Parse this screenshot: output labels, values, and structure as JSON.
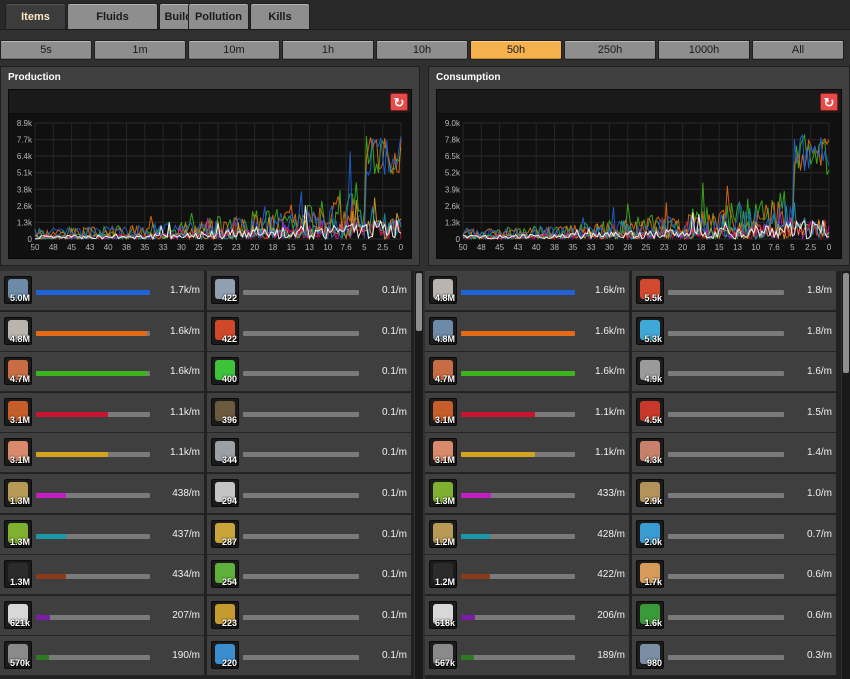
{
  "tabs": [
    {
      "label": "Items",
      "active": true
    },
    {
      "label": "Fluids",
      "active": false
    },
    {
      "label": "Buildings",
      "active": false
    },
    {
      "label": "Pollution",
      "active": false
    },
    {
      "label": "Kills",
      "active": false
    }
  ],
  "timeframes": [
    {
      "label": "5s",
      "active": false
    },
    {
      "label": "1m",
      "active": false
    },
    {
      "label": "10m",
      "active": false
    },
    {
      "label": "1h",
      "active": false
    },
    {
      "label": "10h",
      "active": false
    },
    {
      "label": "50h",
      "active": true
    },
    {
      "label": "250h",
      "active": false
    },
    {
      "label": "1000h",
      "active": false
    },
    {
      "label": "All",
      "active": false
    }
  ],
  "production": {
    "title": "Production",
    "reset_label": "↻",
    "y_ticks": [
      "8.9k",
      "7.7k",
      "6.4k",
      "5.1k",
      "3.8k",
      "2.6k",
      "1.3k",
      "0"
    ],
    "x_ticks": [
      "50",
      "48",
      "45",
      "43",
      "40",
      "38",
      "35",
      "33",
      "30",
      "28",
      "25",
      "23",
      "20",
      "18",
      "15",
      "13",
      "10",
      "7.6",
      "5",
      "2.5",
      "0"
    ],
    "left_items": [
      {
        "icon": "iron-ore-icon",
        "count": "5.0M",
        "rate": "1.7k/m",
        "fill": 1.0,
        "color": "#1f63d6",
        "ic": "#6d8aa8"
      },
      {
        "icon": "stone-icon",
        "count": "4.8M",
        "rate": "1.6k/m",
        "fill": 0.97,
        "color": "#e36a16",
        "ic": "#b9b4ad"
      },
      {
        "icon": "copper-cable-icon",
        "count": "4.7M",
        "rate": "1.6k/m",
        "fill": 0.97,
        "color": "#3bb41e",
        "ic": "#c86d43"
      },
      {
        "icon": "copper-ore-icon",
        "count": "3.1M",
        "rate": "1.1k/m",
        "fill": 0.63,
        "color": "#c8142f",
        "ic": "#c65e2c"
      },
      {
        "icon": "copper-plate-icon",
        "count": "3.1M",
        "rate": "1.1k/m",
        "fill": 0.63,
        "color": "#d5a41f",
        "ic": "#d98a6a"
      },
      {
        "icon": "iron-gear-icon",
        "count": "1.3M",
        "rate": "438/m",
        "fill": 0.26,
        "color": "#c21ec4",
        "ic": "#b69a56"
      },
      {
        "icon": "electronic-circuit-icon",
        "count": "1.3M",
        "rate": "437/m",
        "fill": 0.26,
        "color": "#1a98a8",
        "ic": "#7fb030"
      },
      {
        "icon": "coal-icon",
        "count": "1.3M",
        "rate": "434/m",
        "fill": 0.26,
        "color": "#8a3a18",
        "ic": "#2b2b2b"
      },
      {
        "icon": "iron-plate-icon",
        "count": "621k",
        "rate": "207/m",
        "fill": 0.12,
        "color": "#7a1ca8",
        "ic": "#d8d8d8"
      },
      {
        "icon": "gear-wheel-icon",
        "count": "570k",
        "rate": "190/m",
        "fill": 0.11,
        "color": "#2e7a22",
        "ic": "#8a8a8a"
      }
    ],
    "right_items": [
      {
        "icon": "pipe-icon",
        "count": "422",
        "rate": "0.1/m",
        "fill": 0.0,
        "color": "#888888",
        "ic": "#8fa0b0"
      },
      {
        "icon": "red-wire-icon",
        "count": "422",
        "rate": "0.1/m",
        "fill": 0.0,
        "color": "#888888",
        "ic": "#d0482a"
      },
      {
        "icon": "green-wire-icon",
        "count": "400",
        "rate": "0.1/m",
        "fill": 0.0,
        "color": "#888888",
        "ic": "#3ec23a"
      },
      {
        "icon": "small-pole-icon",
        "count": "396",
        "rate": "0.1/m",
        "fill": 0.0,
        "color": "#888888",
        "ic": "#6b5a3e"
      },
      {
        "icon": "medium-pole-icon",
        "count": "344",
        "rate": "0.1/m",
        "fill": 0.0,
        "color": "#888888",
        "ic": "#9aa0a6"
      },
      {
        "icon": "repair-pack-icon",
        "count": "294",
        "rate": "0.1/m",
        "fill": 0.0,
        "color": "#888888",
        "ic": "#c4c4c4"
      },
      {
        "icon": "transport-belt-icon",
        "count": "287",
        "rate": "0.1/m",
        "fill": 0.0,
        "color": "#888888",
        "ic": "#c9a43a"
      },
      {
        "icon": "underground-belt-icon",
        "count": "254",
        "rate": "0.1/m",
        "fill": 0.0,
        "color": "#888888",
        "ic": "#5fb03a"
      },
      {
        "icon": "splitter-icon",
        "count": "223",
        "rate": "0.1/m",
        "fill": 0.0,
        "color": "#888888",
        "ic": "#c59a2e"
      },
      {
        "icon": "fast-splitter-icon",
        "count": "220",
        "rate": "0.1/m",
        "fill": 0.0,
        "color": "#888888",
        "ic": "#3a8ed0"
      }
    ]
  },
  "consumption": {
    "title": "Consumption",
    "reset_label": "↻",
    "y_ticks": [
      "9.0k",
      "7.8k",
      "6.5k",
      "5.2k",
      "3.9k",
      "2.6k",
      "1.3k",
      "0"
    ],
    "x_ticks": [
      "50",
      "48",
      "45",
      "43",
      "40",
      "38",
      "35",
      "33",
      "30",
      "28",
      "25",
      "23",
      "20",
      "18",
      "15",
      "13",
      "10",
      "7.6",
      "5",
      "2.5",
      "0"
    ],
    "left_items": [
      {
        "icon": "stone-icon",
        "count": "4.8M",
        "rate": "1.6k/m",
        "fill": 1.0,
        "color": "#1f63d6",
        "ic": "#b9b4ad"
      },
      {
        "icon": "iron-ore-icon",
        "count": "4.8M",
        "rate": "1.6k/m",
        "fill": 1.0,
        "color": "#e36a16",
        "ic": "#6d8aa8"
      },
      {
        "icon": "copper-cable-icon",
        "count": "4.7M",
        "rate": "1.6k/m",
        "fill": 1.0,
        "color": "#3bb41e",
        "ic": "#c86d43"
      },
      {
        "icon": "copper-ore-icon",
        "count": "3.1M",
        "rate": "1.1k/m",
        "fill": 0.65,
        "color": "#c8142f",
        "ic": "#c65e2c"
      },
      {
        "icon": "copper-plate-icon",
        "count": "3.1M",
        "rate": "1.1k/m",
        "fill": 0.65,
        "color": "#d5a41f",
        "ic": "#d98a6a"
      },
      {
        "icon": "electronic-circuit-icon",
        "count": "1.3M",
        "rate": "433/m",
        "fill": 0.26,
        "color": "#c21ec4",
        "ic": "#7fb030"
      },
      {
        "icon": "iron-gear-icon",
        "count": "1.2M",
        "rate": "428/m",
        "fill": 0.25,
        "color": "#1a98a8",
        "ic": "#b69a56"
      },
      {
        "icon": "coal-icon",
        "count": "1.2M",
        "rate": "422/m",
        "fill": 0.25,
        "color": "#8a3a18",
        "ic": "#2b2b2b"
      },
      {
        "icon": "iron-plate-icon",
        "count": "618k",
        "rate": "206/m",
        "fill": 0.12,
        "color": "#7a1ca8",
        "ic": "#d8d8d8"
      },
      {
        "icon": "gear-wheel-icon",
        "count": "567k",
        "rate": "189/m",
        "fill": 0.11,
        "color": "#2e7a22",
        "ic": "#8a8a8a"
      }
    ],
    "right_items": [
      {
        "icon": "automation-science-pack-icon",
        "count": "5.5k",
        "rate": "1.8/m",
        "fill": 0.0,
        "color": "#888888",
        "ic": "#d2492f"
      },
      {
        "icon": "logistic-science-pack-icon",
        "count": "5.3k",
        "rate": "1.8/m",
        "fill": 0.0,
        "color": "#888888",
        "ic": "#3ea8d6"
      },
      {
        "icon": "engine-unit-icon",
        "count": "4.9k",
        "rate": "1.6/m",
        "fill": 0.0,
        "color": "#888888",
        "ic": "#9a9a9a"
      },
      {
        "icon": "red-ammo-icon",
        "count": "4.5k",
        "rate": "1.5/m",
        "fill": 0.0,
        "color": "#888888",
        "ic": "#c8382a"
      },
      {
        "icon": "stone-furnace-icon",
        "count": "4.3k",
        "rate": "1.4/m",
        "fill": 0.0,
        "color": "#888888",
        "ic": "#c8806a"
      },
      {
        "icon": "wooden-chest-icon",
        "count": "2.9k",
        "rate": "1.0/m",
        "fill": 0.0,
        "color": "#888888",
        "ic": "#b4935a"
      },
      {
        "icon": "inserter-icon",
        "count": "2.0k",
        "rate": "0.7/m",
        "fill": 0.0,
        "color": "#888888",
        "ic": "#3a9ad2"
      },
      {
        "icon": "lab-icon",
        "count": "1.7k",
        "rate": "0.6/m",
        "fill": 0.0,
        "color": "#888888",
        "ic": "#d69a5a"
      },
      {
        "icon": "wood-icon",
        "count": "1.6k",
        "rate": "0.6/m",
        "fill": 0.0,
        "color": "#888888",
        "ic": "#3a9a3a"
      },
      {
        "icon": "assembler-icon",
        "count": "980",
        "rate": "0.3/m",
        "fill": 0.0,
        "color": "#888888",
        "ic": "#7a8ea6"
      }
    ]
  },
  "series_colors": [
    "#3bb41e",
    "#e36a16",
    "#1f63d6",
    "#c21ec4",
    "#d5a41f",
    "#c8142f",
    "#1a98a8",
    "#ffffff"
  ]
}
